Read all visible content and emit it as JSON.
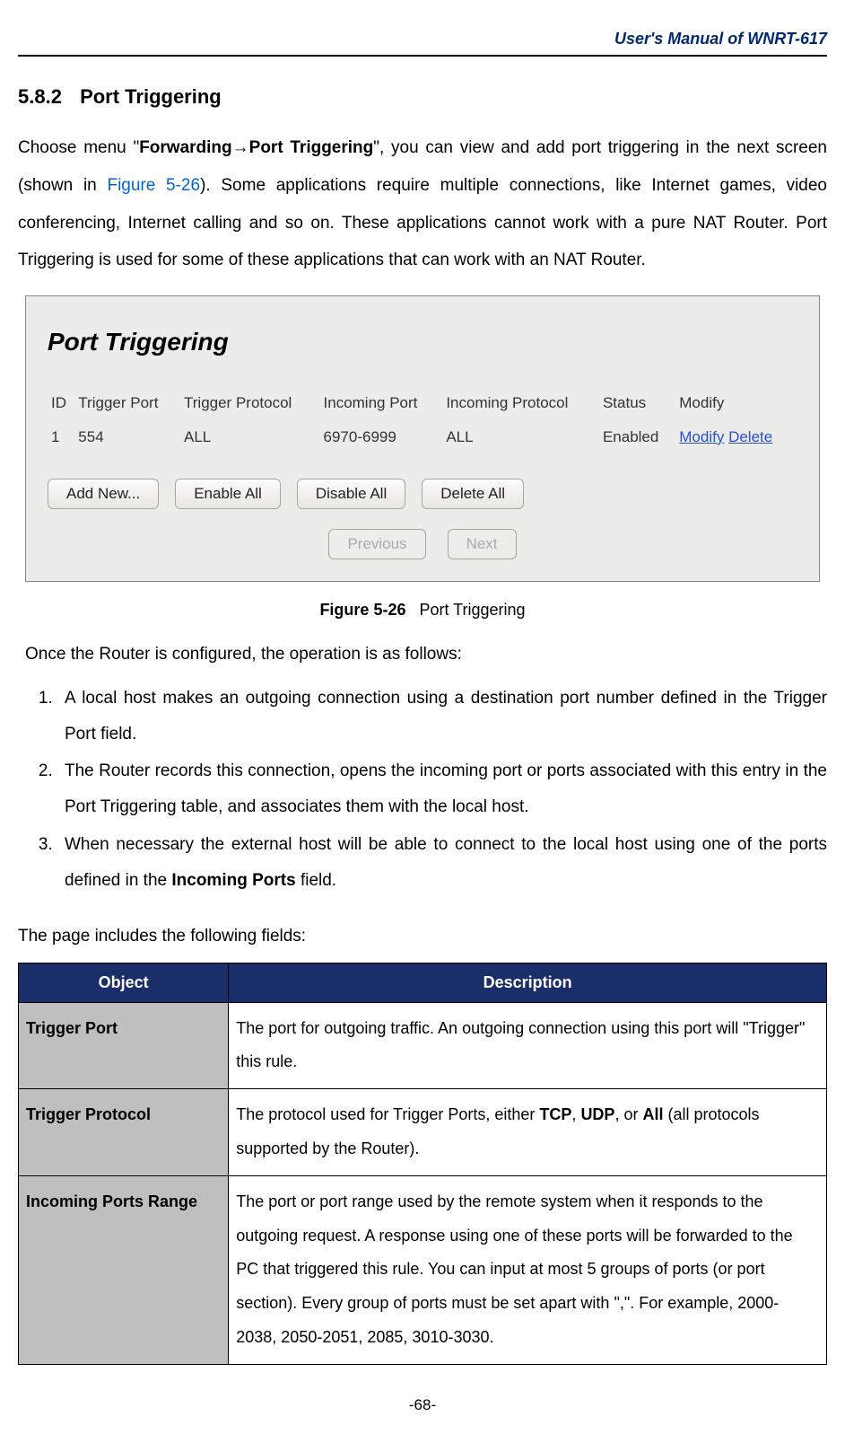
{
  "header": {
    "title": "User's Manual of WNRT-617"
  },
  "section": {
    "number": "5.8.2",
    "title": "Port Triggering"
  },
  "intro": {
    "prefix": "Choose menu \"",
    "menu": "Forwarding→Port Triggering",
    "afterMenu": "\", you can view and add port triggering in the next screen (shown in ",
    "figref": "Figure 5-26",
    "afterFig": "). Some applications require multiple connections, like Internet games, video conferencing, Internet calling and so on. These applications cannot work with a pure NAT Router. Port Triggering is used for some of these applications that can work with an NAT Router."
  },
  "screenshot": {
    "title": "Port Triggering",
    "headers": [
      "ID",
      "Trigger Port",
      "Trigger Protocol",
      "Incoming Port",
      "Incoming Protocol",
      "Status",
      "Modify"
    ],
    "row": {
      "id": "1",
      "triggerPort": "554",
      "triggerProtocol": "ALL",
      "incomingPort": "6970-6999",
      "incomingProtocol": "ALL",
      "status": "Enabled",
      "modify": "Modify",
      "delete": "Delete"
    },
    "buttons": {
      "addNew": "Add New...",
      "enableAll": "Enable All",
      "disableAll": "Disable All",
      "deleteAll": "Delete All",
      "previous": "Previous",
      "next": "Next"
    }
  },
  "figureCaption": {
    "label": "Figure 5-26",
    "text": "Port Triggering"
  },
  "once": "Once the Router is configured, the operation is as follows:",
  "steps": [
    "A local host makes an outgoing connection using a destination port number defined in the Trigger Port field.",
    "The Router records this connection, opens the incoming port or ports associated with this entry in the Port Triggering table, and associates them with the local host.",
    {
      "pre": "When necessary the external host will be able to connect to the local host using one of the ports defined in the ",
      "bold": "Incoming Ports",
      "post": " field."
    }
  ],
  "fieldsIntro": "The page includes the following fields:",
  "table": {
    "headers": {
      "object": "Object",
      "description": "Description"
    },
    "rows": [
      {
        "object": "Trigger Port",
        "desc": "The port for outgoing traffic. An outgoing connection using this port will \"Trigger\" this rule."
      },
      {
        "object": "Trigger Protocol",
        "desc": {
          "pre": "The protocol used for Trigger Ports, either ",
          "b1": "TCP",
          "mid1": ", ",
          "b2": "UDP",
          "mid2": ", or ",
          "b3": "All",
          "post": " (all protocols supported by the Router)."
        }
      },
      {
        "object": "Incoming Ports Range",
        "desc": "The port or port range used by the remote system when it responds to the outgoing request. A response using one of these ports will be forwarded to the PC that triggered this rule. You can input at most 5 groups of ports (or port section). Every group of ports must be set apart with \",\". For example, 2000-2038, 2050-2051, 2085, 3010-3030."
      }
    ]
  },
  "footer": "-68-"
}
